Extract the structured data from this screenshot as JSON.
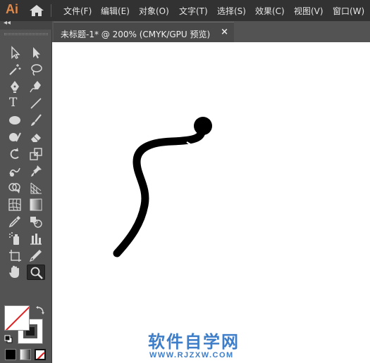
{
  "app": {
    "logo": "Ai"
  },
  "menu": [
    "文件(F)",
    "编辑(E)",
    "对象(O)",
    "文字(T)",
    "选择(S)",
    "效果(C)",
    "视图(V)",
    "窗口(W)"
  ],
  "tab": {
    "title": "未标题-1* @ 200% (CMYK/GPU 预览)",
    "close": "×"
  },
  "toolpanel": {
    "collapse": "◂◂",
    "type_tool": "T"
  },
  "colors": {
    "accent_logo": "#e0894a",
    "canvas": "#ffffff",
    "stroke": "#000000",
    "watermark": "#3e7ec9"
  },
  "watermark": {
    "main": "软件自学网",
    "sub": "WWW.RJZXW.COM"
  }
}
